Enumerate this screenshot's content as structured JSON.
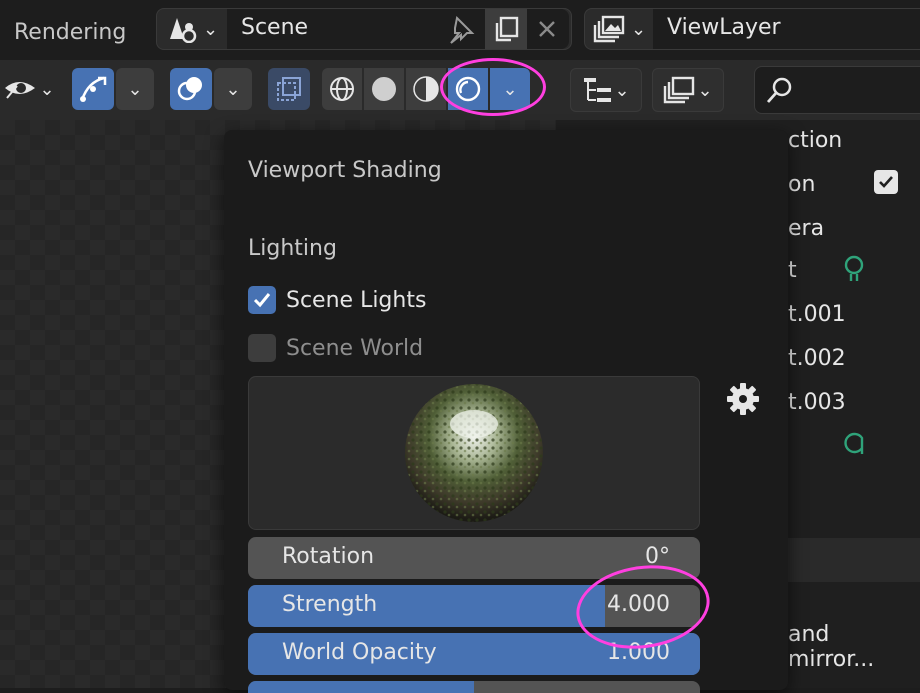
{
  "header": {
    "workspace_tab": "Rendering",
    "scene_name": "Scene",
    "view_layer": "ViewLayer"
  },
  "popover": {
    "title": "Viewport Shading",
    "section": "Lighting",
    "scene_lights": {
      "label": "Scene Lights",
      "checked": true
    },
    "scene_world": {
      "label": "Scene World",
      "checked": false
    },
    "sliders": [
      {
        "label": "Rotation",
        "value": "0°",
        "fill": 0
      },
      {
        "label": "Strength",
        "value": "4.000",
        "fill": 0.79
      },
      {
        "label": "World Opacity",
        "value": "1.000",
        "fill": 1.0
      }
    ]
  },
  "outliner": {
    "rows": [
      "ction",
      "on",
      "era",
      "t",
      "t.001",
      "t.002",
      "t.003"
    ],
    "partial_bottom": "and mirror..."
  },
  "colors": {
    "accent": "#4772b3",
    "annotation": "#ff3fe0",
    "light_icon": "#2fa37a"
  }
}
